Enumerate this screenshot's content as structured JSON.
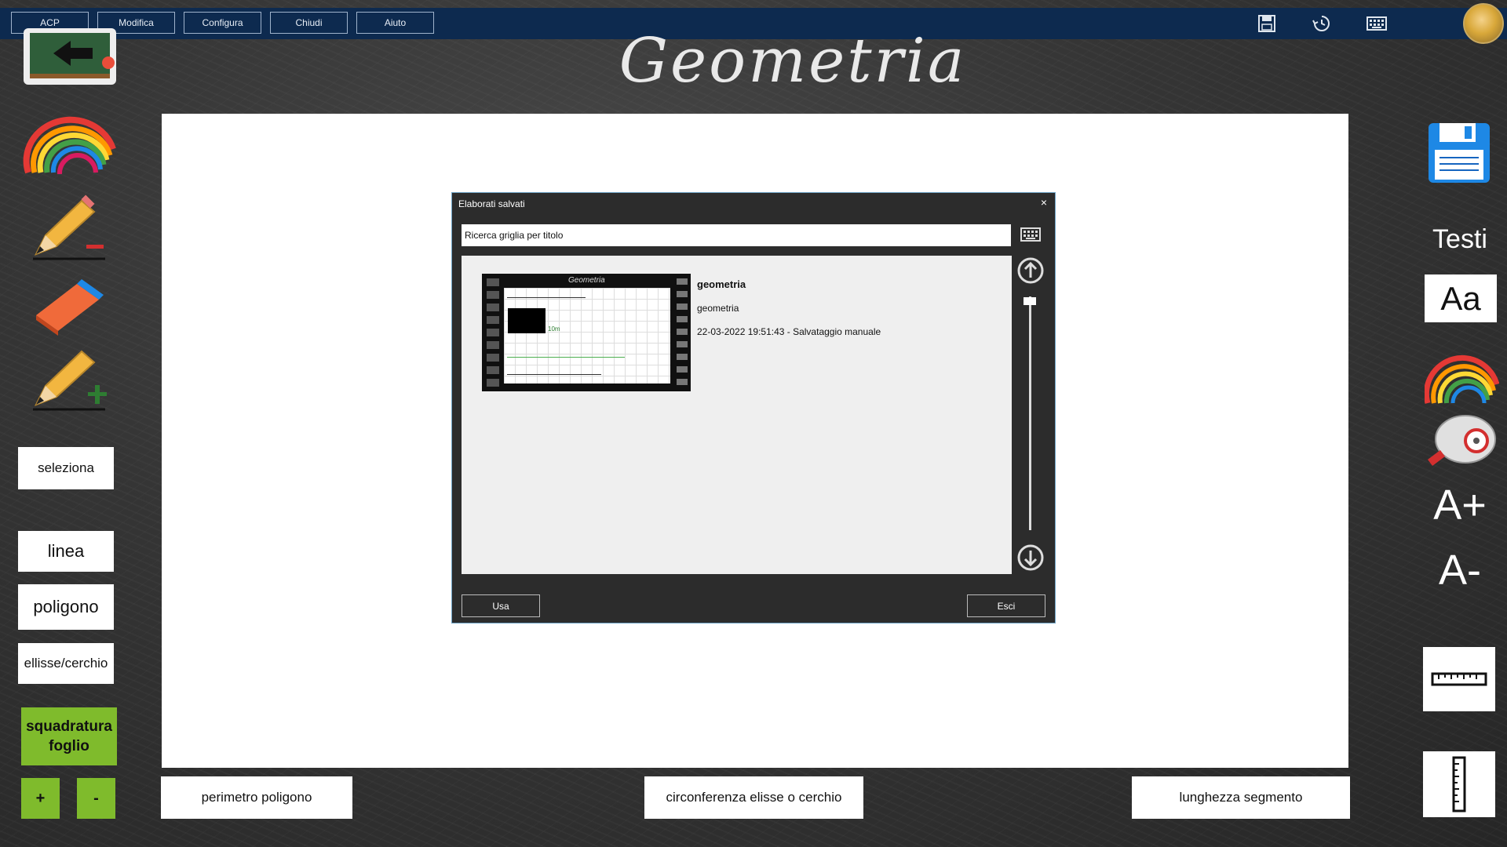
{
  "menu": {
    "items": [
      {
        "label": "ACP"
      },
      {
        "label": "Modifica"
      },
      {
        "label": "Configura"
      },
      {
        "label": "Chiudi"
      },
      {
        "label": "Aiuto"
      }
    ]
  },
  "header": {
    "title": "Geometria"
  },
  "left_tools": {
    "seleziona": "seleziona",
    "linea": "linea",
    "poligono": "poligono",
    "ellisse": "ellisse/cerchio",
    "squadratura": "squadratura foglio",
    "plus": "+",
    "minus": "-"
  },
  "bottom_buttons": {
    "perimetro": "perimetro poligono",
    "circonferenza": "circonferenza elisse o cerchio",
    "lunghezza": "lunghezza segmento"
  },
  "right_tools": {
    "testi": "Testi",
    "font_sample": "Aa",
    "increase_font": "A+",
    "decrease_font": "A-"
  },
  "dialog": {
    "title": "Elaborati salvati",
    "close": "×",
    "search_value": "Ricerca griglia per titolo",
    "item": {
      "title": "geometria",
      "subtitle": "geometria",
      "date": "22-03-2022 19:51:43 - Salvataggio manuale",
      "thumb_title": "Geometria",
      "thumb_measure": "10m"
    },
    "use_label": "Usa",
    "exit_label": "Esci"
  },
  "colors": {
    "menubar": "#0d2a4f",
    "green_accent": "#7fbb2c",
    "dialog_bg": "#2c2c2c"
  }
}
